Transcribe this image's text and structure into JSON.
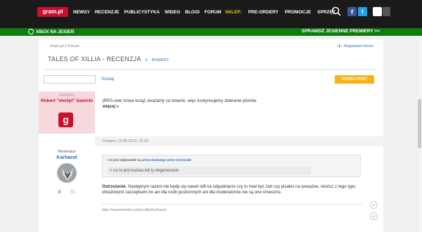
{
  "header": {
    "logo": "gram.pl",
    "nav": [
      "NEWSY",
      "RECENZJE",
      "PUBLICYSTYKA",
      "WIDEO",
      "BLOGI",
      "FORUM"
    ],
    "shop_label": "SKLEP:",
    "shop_items": [
      "PRE-ORDERY",
      "PROMOCJE",
      "SPRZĘT"
    ],
    "social": {
      "facebook": "f",
      "twitter": "t"
    }
  },
  "promo_bar": {
    "left": "XBOX NA JESIEŃ",
    "right": "SPRAWDŹ JESIENNE PREMIERY >>",
    "color": "#107c10"
  },
  "forum": {
    "breadcrumb": "Gram.pl  //  Forum",
    "regulamin": "Regulamin forum",
    "title": "TALES OF XILLIA - RECENZJA",
    "title_sep": "//",
    "back": "POWRÓT",
    "search_button": "Szukaj",
    "add_post": "DODAJ POST"
  },
  "post1": {
    "role": "GRAM.PL",
    "author": "Robert \"ww3pl\" Sawicki",
    "logo_letter": "g",
    "text": "jRPG-owe żniwa wciąż uważamy za otwarte, więc kontynuujemy zbieranie plonów.",
    "more": "więcej »",
    "date": "Dodano 12.08.2013, 15:00"
  },
  "post2": {
    "role": "Moderator",
    "author": "Karharot",
    "quote_header_prefix": "> to jest odpowiedź na",
    "quote_header_link": "posta dodanego przez Ostrowiak",
    "quote_text": "> co to jest kużwa loli ty degeneracie",
    "warning_bold": "Ostrzeżenie",
    "warning_text": ". Następnym razem nie będę się nawet silił na odgadnięcie czy to miał być żart czy pisałeś na poważne, skończ z tego typu obraźliwymi zaczepkami bo ani dla osób postronnych ani dla moderatorów nie są one śmieszne.",
    "signature": "http://myanimelist.net/profile/Karharot"
  },
  "colors": {
    "accent": "#c8102e",
    "link": "#2a6db0",
    "button": "#f5b317"
  }
}
